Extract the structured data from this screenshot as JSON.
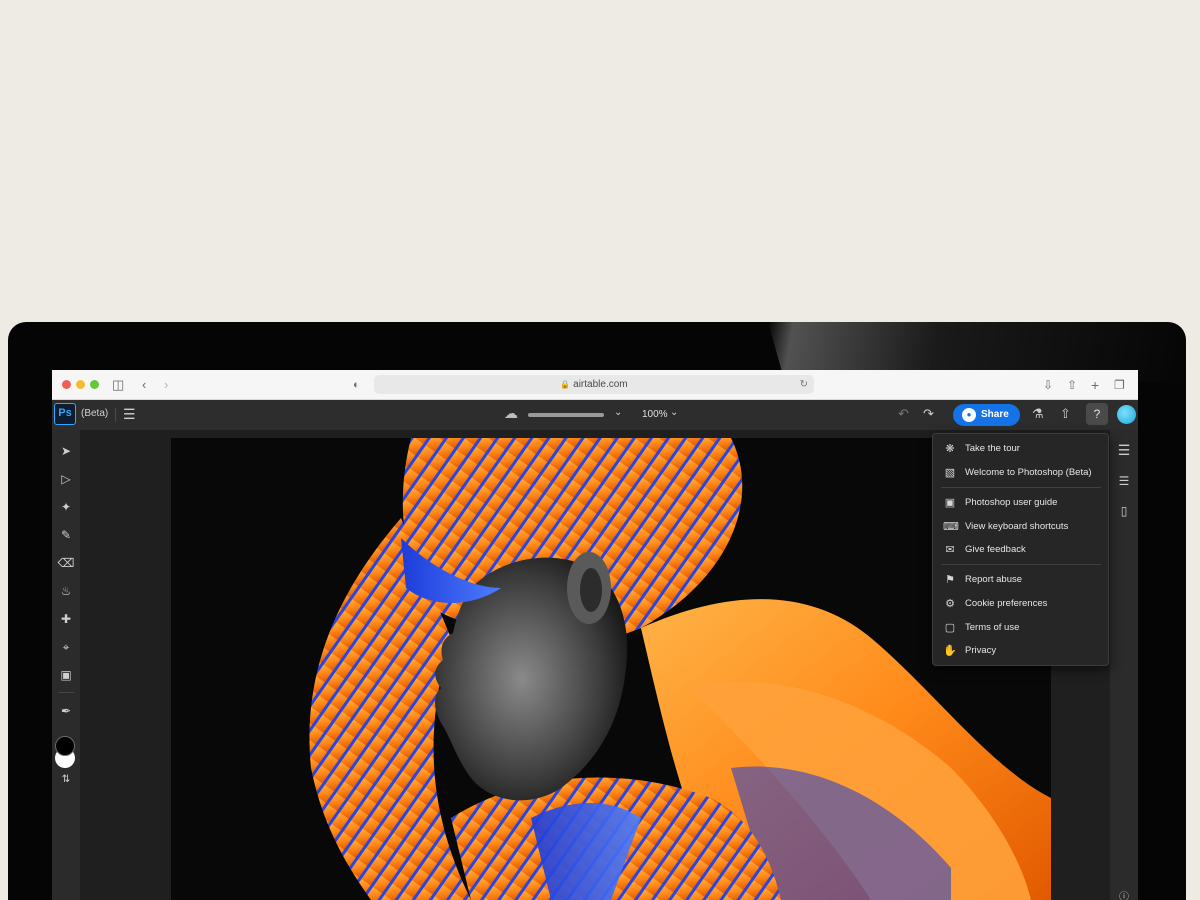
{
  "browser": {
    "url": "airtable.com",
    "icons": {
      "sidebar": "sidebar-icon",
      "back": "chevron-left-icon",
      "forward": "chevron-right-icon",
      "privacy": "shield-icon",
      "reload": "reload-icon",
      "download": "download-icon",
      "share": "share-icon",
      "new_tab": "plus-icon",
      "tabs": "tabs-icon"
    }
  },
  "app": {
    "logo": "Ps",
    "badge": "(Beta)",
    "zoom": "100%",
    "share_label": "Share",
    "save_progress": 1.0,
    "colors": {
      "accent": "#1473e6",
      "logo_border": "#31a8ff"
    }
  },
  "help_menu": {
    "items": [
      {
        "label": "Take the tour",
        "icon": "lightbulb-icon"
      },
      {
        "label": "Welcome to Photoshop (Beta)",
        "icon": "gift-icon"
      },
      {
        "label": "Photoshop user guide",
        "icon": "guide-icon"
      },
      {
        "label": "View keyboard shortcuts",
        "icon": "keyboard-icon"
      },
      {
        "label": "Give feedback",
        "icon": "feedback-icon"
      },
      {
        "label": "Report abuse",
        "icon": "flag-icon"
      },
      {
        "label": "Cookie preferences",
        "icon": "sliders-icon"
      },
      {
        "label": "Terms of use",
        "icon": "document-icon"
      },
      {
        "label": "Privacy",
        "icon": "hand-icon"
      }
    ]
  },
  "tools": [
    "select-icon",
    "transform-icon",
    "quick-select-icon",
    "brush-icon",
    "eraser-icon",
    "fill-icon",
    "healing-icon",
    "crop-icon",
    "image-icon",
    "eyedropper-icon"
  ],
  "right_panel": [
    "layers-icon",
    "adjustments-icon",
    "comments-icon",
    "info-icon"
  ],
  "swatches": {
    "foreground": "#000000",
    "background": "#ffffff"
  }
}
